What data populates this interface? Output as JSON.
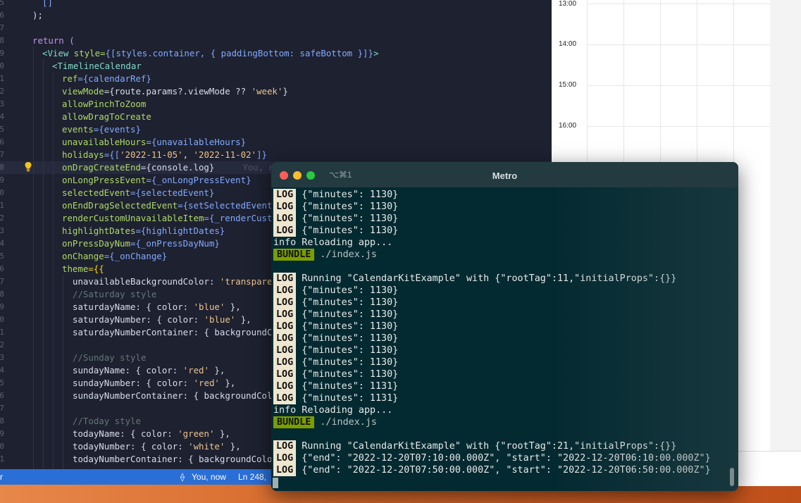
{
  "editor": {
    "lines": [
      {
        "n": "5"
      },
      {
        "n": "6"
      },
      {
        "n": "7"
      },
      {
        "n": "8"
      },
      {
        "n": "9"
      },
      {
        "n": "0"
      },
      {
        "n": "1"
      },
      {
        "n": "2"
      },
      {
        "n": "3"
      },
      {
        "n": "4"
      },
      {
        "n": "5"
      },
      {
        "n": "6"
      },
      {
        "n": "7"
      },
      {
        "n": "8"
      },
      {
        "n": "9"
      },
      {
        "n": "0"
      },
      {
        "n": "1"
      },
      {
        "n": "2"
      },
      {
        "n": "3"
      },
      {
        "n": "4"
      },
      {
        "n": "5"
      },
      {
        "n": "6"
      },
      {
        "n": "7"
      },
      {
        "n": "8"
      },
      {
        "n": "9"
      },
      {
        "n": "0"
      },
      {
        "n": "1"
      },
      {
        "n": "2"
      },
      {
        "n": "3"
      },
      {
        "n": "4"
      },
      {
        "n": "5"
      },
      {
        "n": "6"
      },
      {
        "n": "7"
      },
      {
        "n": "8"
      },
      {
        "n": "9"
      },
      {
        "n": "0"
      },
      {
        "n": "1"
      }
    ],
    "code": {
      "l0": "[]",
      "l1": ");",
      "l3": "return (",
      "l4a": "<View",
      "l4b": " style=",
      "l4c": "{[styles.container, { paddingBottom: safeBottom }]}",
      "l4d": ">",
      "l5": "<TimelineCalendar",
      "l6a": "ref",
      "l6b": "={calendarRef}",
      "l7a": "viewMode",
      "l7b": "={route.params?.viewMode ?? ",
      "l7c": "'week'",
      "l7d": "}",
      "l8": "allowPinchToZoom",
      "l9": "allowDragToCreate",
      "l10a": "events",
      "l10b": "={events}",
      "l11a": "unavailableHours",
      "l11b": "={unavailableHours}",
      "l12a": "holidays",
      "l12b": "={[",
      "l12c": "'2022-11-05'",
      "l12d": ", ",
      "l12e": "'2022-11-02'",
      "l12f": "]}",
      "l13a": "onDragCreateEnd",
      "l13b": "={console.log}",
      "l13ghost": "You, n",
      "l14a": "onLongPressEvent",
      "l14b": "={_onLongPressEvent}",
      "l15a": "selectedEvent",
      "l15b": "={selectedEvent}",
      "l16a": "onEndDragSelectedEvent",
      "l16b": "={setSelectedEvent}",
      "l17a": "renderCustomUnavailableItem",
      "l17b": "={_renderCusto",
      "l18a": "highlightDates",
      "l18b": "={highlightDates}",
      "l19a": "onPressDayNum",
      "l19b": "={_onPressDayNum}",
      "l20a": "onChange",
      "l20b": "={_onChange}",
      "l21a": "theme",
      "l21b": "={{",
      "l22a": "unavailableBackgroundColor: ",
      "l22b": "'transparen",
      "l23": "//Saturday style",
      "l24a": "saturdayName: { color: ",
      "l24b": "'blue'",
      "l24c": " },",
      "l25a": "saturdayNumber: { color: ",
      "l25b": "'blue'",
      "l25c": " },",
      "l26": "saturdayNumberContainer: { backgroundCo",
      "l28": "//Sunday style",
      "l29a": "sundayName: { color: ",
      "l29b": "'red'",
      "l29c": " },",
      "l30a": "sundayNumber: { color: ",
      "l30b": "'red'",
      "l30c": " },",
      "l31": "sundayNumberContainer: { backgroundColo",
      "l33": "//Today style",
      "l34a": "todayName: { color: ",
      "l34b": "'green'",
      "l34c": " },",
      "l35a": "todayNumber: { color: ",
      "l35b": "'white'",
      "l35c": " },",
      "l36": "todayNumberContainer: { backgroundColo"
    }
  },
  "statusbar": {
    "left": "r",
    "git_blame": "You, now",
    "position": "Ln 248,"
  },
  "calendar": {
    "hours": [
      "13:00",
      "14:00",
      "15:00",
      "16:00"
    ]
  },
  "terminal": {
    "shortcut": "⌥⌘1",
    "title": "Metro",
    "badge_log": "LOG",
    "badge_bundle": "BUNDLE",
    "lines": [
      {
        "badge": "LOG",
        "text": "{\"minutes\": 1130}"
      },
      {
        "badge": "LOG",
        "text": "{\"minutes\": 1130}"
      },
      {
        "badge": "LOG",
        "text": "{\"minutes\": 1130}"
      },
      {
        "badge": "LOG",
        "text": "{\"minutes\": 1130}"
      },
      {
        "badge": "",
        "text": "info Reloading app..."
      },
      {
        "badge": "BUNDLE",
        "text": "./index.js"
      },
      {
        "badge": "",
        "text": ""
      },
      {
        "badge": "LOG",
        "text": "Running \"CalendarKitExample\" with {\"rootTag\":11,\"initialProps\":{}}"
      },
      {
        "badge": "LOG",
        "text": "{\"minutes\": 1130}"
      },
      {
        "badge": "LOG",
        "text": "{\"minutes\": 1130}"
      },
      {
        "badge": "LOG",
        "text": "{\"minutes\": 1130}"
      },
      {
        "badge": "LOG",
        "text": "{\"minutes\": 1130}"
      },
      {
        "badge": "LOG",
        "text": "{\"minutes\": 1130}"
      },
      {
        "badge": "LOG",
        "text": "{\"minutes\": 1130}"
      },
      {
        "badge": "LOG",
        "text": "{\"minutes\": 1130}"
      },
      {
        "badge": "LOG",
        "text": "{\"minutes\": 1130}"
      },
      {
        "badge": "LOG",
        "text": "{\"minutes\": 1131}"
      },
      {
        "badge": "LOG",
        "text": "{\"minutes\": 1131}"
      },
      {
        "badge": "",
        "text": "info Reloading app..."
      },
      {
        "badge": "BUNDLE",
        "text": "./index.js"
      },
      {
        "badge": "",
        "text": ""
      },
      {
        "badge": "LOG",
        "text": "Running \"CalendarKitExample\" with {\"rootTag\":21,\"initialProps\":{}}"
      },
      {
        "badge": "LOG",
        "text": "{\"end\": \"2022-12-20T07:10:00.000Z\", \"start\": \"2022-12-20T06:10:00.000Z\"}"
      },
      {
        "badge": "LOG",
        "text": "{\"end\": \"2022-12-20T07:50:00.000Z\", \"start\": \"2022-12-20T06:50:00.000Z\"}"
      }
    ]
  }
}
